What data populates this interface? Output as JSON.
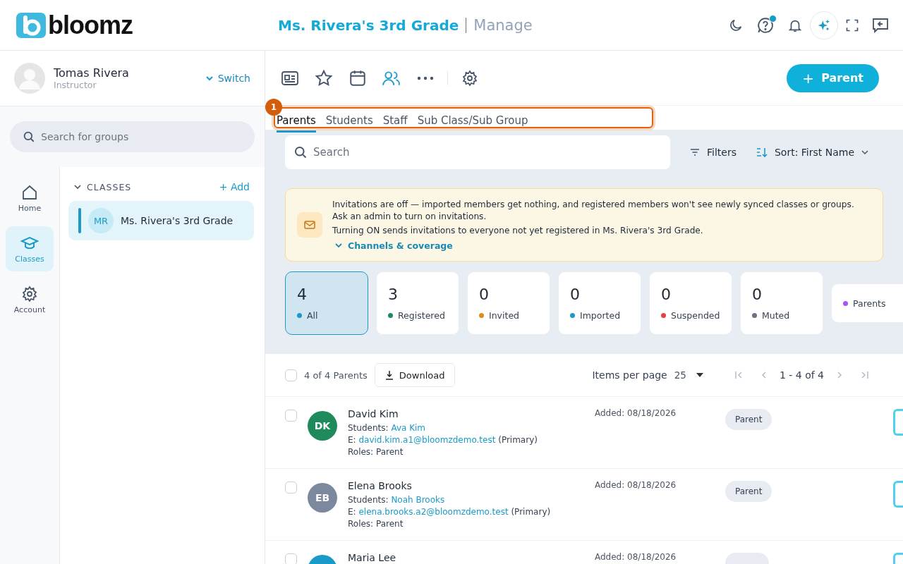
{
  "header": {
    "logo": "bloomz",
    "class_title": "Ms. Rivera's 3rd Grade",
    "section": "Manage",
    "help_has_dot": true
  },
  "user": {
    "name": "Tomas Rivera",
    "role": "Instructor",
    "switch": "Switch"
  },
  "group_search": {
    "placeholder": "Search for groups"
  },
  "nav": [
    {
      "label": "Home",
      "kind": "home",
      "selected": false
    },
    {
      "label": "Classes",
      "kind": "classes",
      "selected": true
    },
    {
      "label": "Account",
      "kind": "account",
      "selected": false
    }
  ],
  "classes": {
    "heading": "CLASSES",
    "add": "+ Add",
    "items": [
      {
        "initials": "MR",
        "name": "Ms. Rivera's 3rd Grade",
        "selected": true
      }
    ]
  },
  "toolbar": {
    "icons": [
      {
        "kind": "card",
        "selected": false
      },
      {
        "kind": "star",
        "selected": false
      },
      {
        "kind": "calendar",
        "selected": false
      },
      {
        "kind": "people",
        "selected": true
      },
      {
        "kind": "more",
        "selected": false
      },
      {
        "kind": "gear",
        "selected": false
      }
    ],
    "add_button": "Parent",
    "add_button_icon": "+"
  },
  "tabs": [
    {
      "label": "Parents",
      "selected": true
    },
    {
      "label": "Students",
      "selected": false
    },
    {
      "label": "Staff",
      "selected": false
    },
    {
      "label": "Sub Class/Sub Group",
      "selected": false
    }
  ],
  "annotation": {
    "number": "1"
  },
  "search": {
    "placeholder": "Search"
  },
  "filters": "Filters",
  "sort": "Sort: First Name",
  "banner": {
    "line_1": "Invitations are off — imported members get nothing, and registered members won't see newly synced classes or groups.",
    "line_2": "Ask an admin to turn on invitations.",
    "line_3": "Turning ON sends invitations to everyone not yet registered in Ms. Rivera's 3rd Grade.",
    "link": "Channels & coverage"
  },
  "stats": [
    {
      "count": "4",
      "label": "All",
      "color": "#1a9bc7",
      "selected": true
    },
    {
      "count": "3",
      "label": "Registered",
      "color": "#1f8a5b",
      "selected": false
    },
    {
      "count": "0",
      "label": "Invited",
      "color": "#e08a1a",
      "selected": false
    },
    {
      "count": "0",
      "label": "Imported",
      "color": "#1a9bc7",
      "selected": false
    },
    {
      "count": "0",
      "label": "Suspended",
      "color": "#e84040",
      "selected": false
    },
    {
      "count": "0",
      "label": "Muted",
      "color": "#6b7280",
      "selected": false
    },
    {
      "label": "Parents",
      "color": "#a855f7",
      "selected": false
    }
  ],
  "list": {
    "all_checked": false,
    "count": "4 of 4 Parents",
    "download": "Download",
    "items_per_page_label": "Items per page",
    "items_per_page": "25",
    "range": "1 - 4 of 4"
  },
  "rows": [
    {
      "initials": "DK",
      "color": "#1f8a5b",
      "name": "David Kim",
      "students_label": "Students:",
      "student": "Ava Kim",
      "email_label": "E:",
      "email": "david.kim.a1@bloomzdemo.test",
      "email_note": "(Primary)",
      "roles": "Roles: Parent",
      "added": "Added: 08/18/2026",
      "badge": "Parent",
      "checked": false
    },
    {
      "initials": "EB",
      "color": "#7b889e",
      "name": "Elena Brooks",
      "students_label": "Students:",
      "student": "Noah Brooks",
      "email_label": "E:",
      "email": "elena.brooks.a2@bloomzdemo.test",
      "email_note": "(Primary)",
      "roles": "Roles: Parent",
      "added": "Added: 08/18/2026",
      "badge": "Parent",
      "checked": false
    },
    {
      "color": "#1a9bc7",
      "name": "Maria Lee",
      "added": "Added: 08/18/2026",
      "checked": false
    }
  ]
}
